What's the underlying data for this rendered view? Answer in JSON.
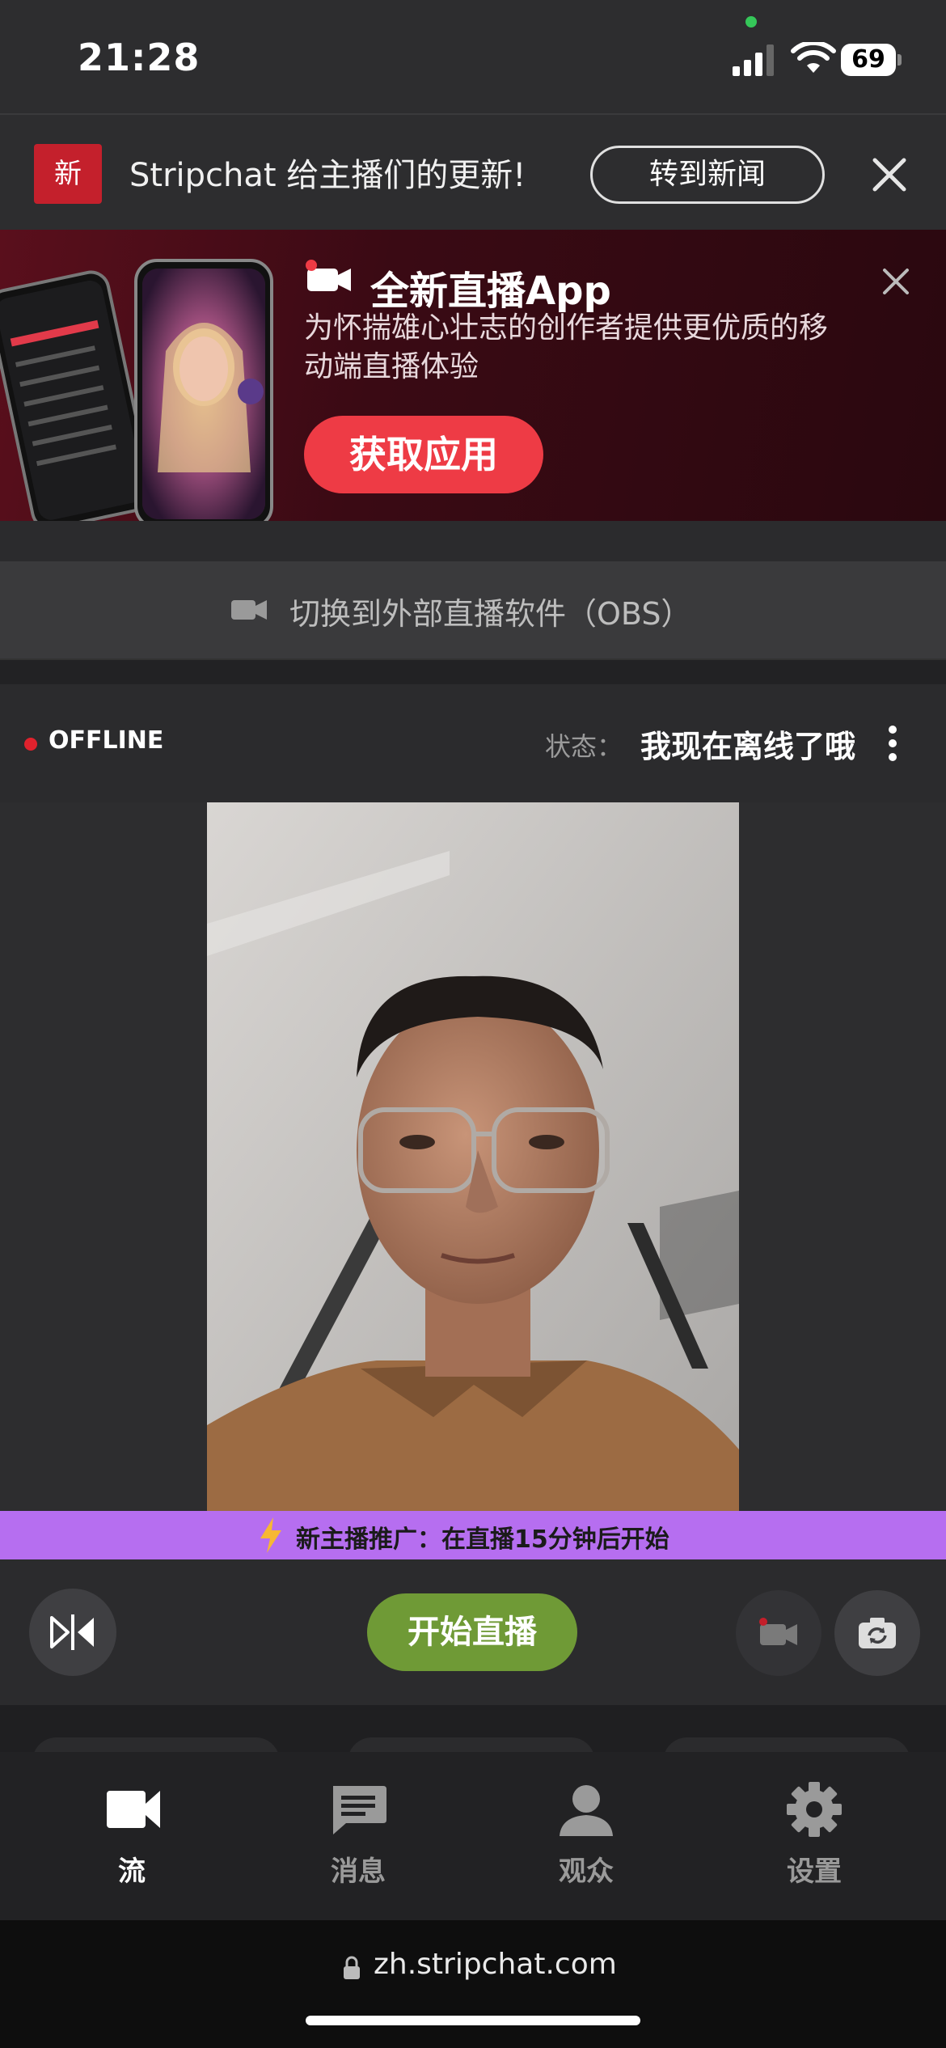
{
  "status_bar": {
    "time": "21:28",
    "battery": "69"
  },
  "news_bar": {
    "badge": "新",
    "text": "Stripchat 给主播们的更新!",
    "button": "转到新闻"
  },
  "promo_banner": {
    "title": "全新直播App",
    "description": "为怀揣雄心壮志的创作者提供更优质的移动端直播体验",
    "button": "获取应用"
  },
  "obs": {
    "label": "切换到外部直播软件（OBS）"
  },
  "stream": {
    "offline_label": "OFFLINE",
    "status_label": "状态：",
    "status_value": "我现在离线了哦"
  },
  "promotion_strip": {
    "text": "新主播推广：在直播15分钟后开始"
  },
  "controls": {
    "start_button": "开始直播"
  },
  "bottom_nav": {
    "items": [
      {
        "label": "流",
        "icon": "video-camera-icon",
        "active": true
      },
      {
        "label": "消息",
        "icon": "chat-bubble-icon",
        "active": false
      },
      {
        "label": "观众",
        "icon": "person-icon",
        "active": false
      },
      {
        "label": "设置",
        "icon": "gear-icon",
        "active": false
      }
    ]
  },
  "browser": {
    "url": "zh.stripchat.com"
  },
  "colors": {
    "accent_red": "#ee3b45",
    "start_green": "#6f9a36",
    "promo_purple": "#b66ef0",
    "offline_red": "#e0222d"
  }
}
